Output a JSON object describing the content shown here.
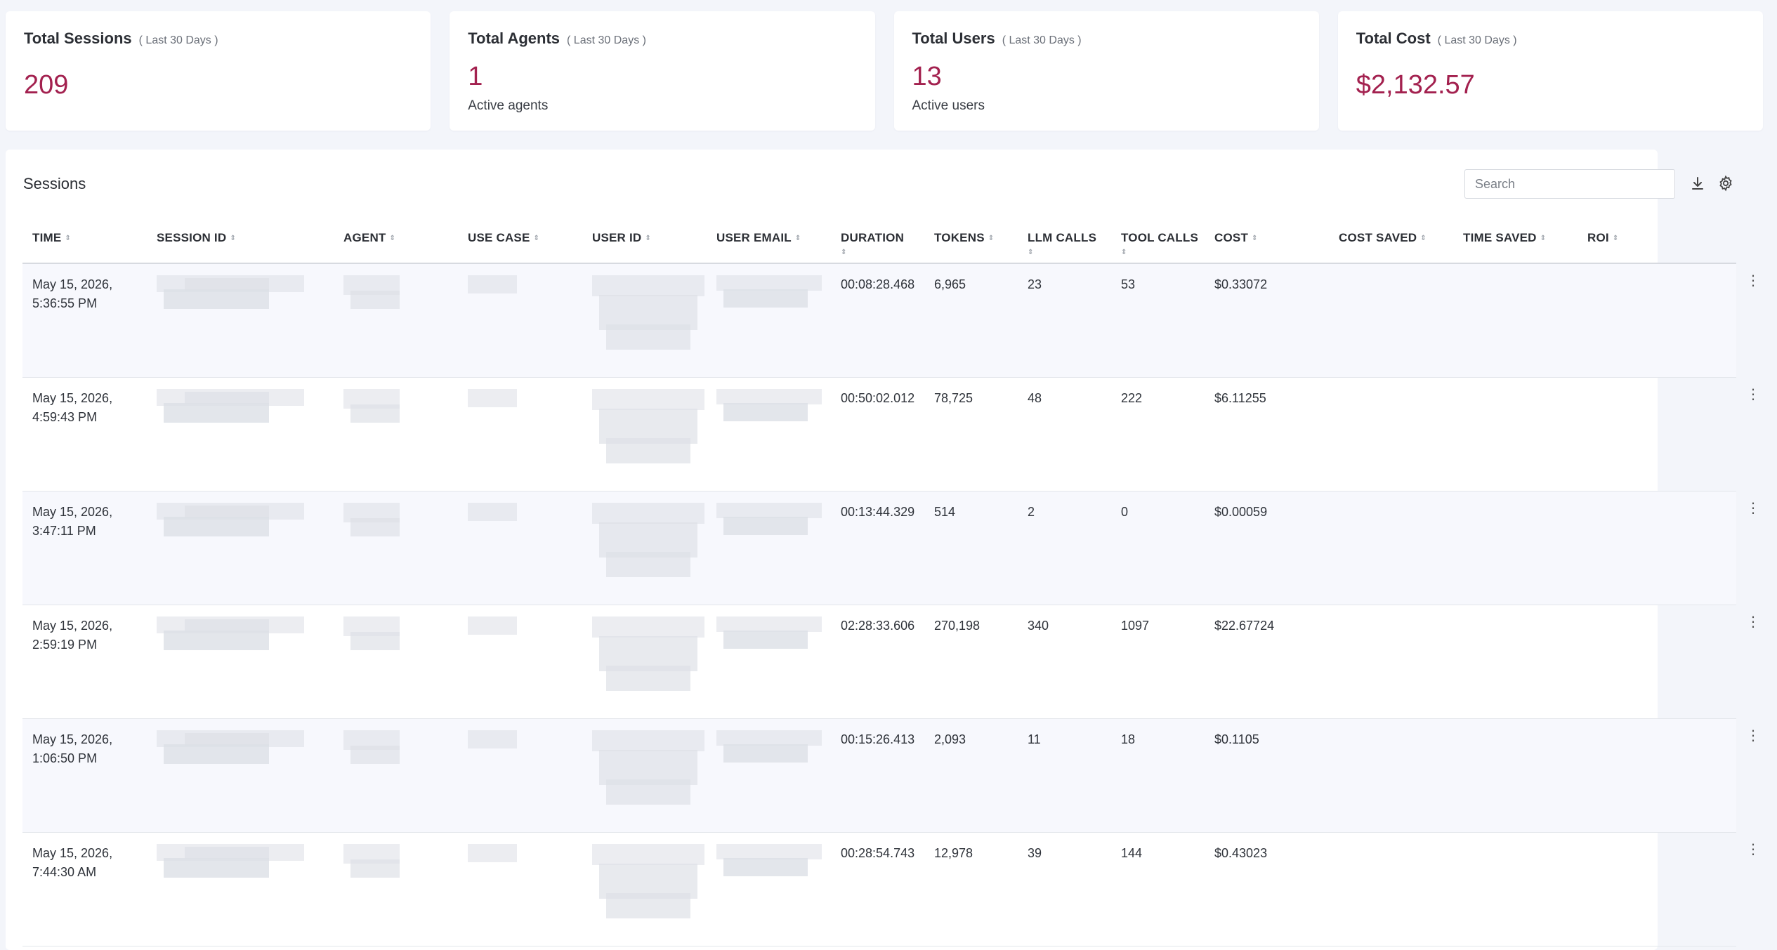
{
  "stats": [
    {
      "title": "Total Sessions",
      "period": "( Last 30 Days )",
      "value": "209",
      "sub": ""
    },
    {
      "title": "Total Agents",
      "period": "( Last 30 Days )",
      "value": "1",
      "sub": "Active agents"
    },
    {
      "title": "Total Users",
      "period": "( Last 30 Days )",
      "value": "13",
      "sub": "Active users"
    },
    {
      "title": "Total Cost",
      "period": "( Last 30 Days )",
      "value": "$2,132.57",
      "sub": ""
    }
  ],
  "sessions": {
    "title": "Sessions",
    "search_placeholder": "Search",
    "columns": [
      "TIME",
      "SESSION ID",
      "AGENT",
      "USE CASE",
      "USER ID",
      "USER EMAIL",
      "DURATION",
      "TOKENS",
      "LLM CALLS",
      "TOOL CALLS",
      "COST",
      "COST SAVED",
      "TIME SAVED",
      "ROI"
    ],
    "rows": [
      {
        "time_date": "May 15, 2026,",
        "time_clock": "5:36:55 PM",
        "duration": "00:08:28.468",
        "tokens": "6,965",
        "llm_calls": "23",
        "tool_calls": "53",
        "cost": "$0.33072",
        "cost_saved": "",
        "time_saved": "",
        "roi": ""
      },
      {
        "time_date": "May 15, 2026,",
        "time_clock": "4:59:43 PM",
        "duration": "00:50:02.012",
        "tokens": "78,725",
        "llm_calls": "48",
        "tool_calls": "222",
        "cost": "$6.11255",
        "cost_saved": "",
        "time_saved": "",
        "roi": ""
      },
      {
        "time_date": "May 15, 2026,",
        "time_clock": "3:47:11 PM",
        "duration": "00:13:44.329",
        "tokens": "514",
        "llm_calls": "2",
        "tool_calls": "0",
        "cost": "$0.00059",
        "cost_saved": "",
        "time_saved": "",
        "roi": ""
      },
      {
        "time_date": "May 15, 2026,",
        "time_clock": "2:59:19 PM",
        "duration": "02:28:33.606",
        "tokens": "270,198",
        "llm_calls": "340",
        "tool_calls": "1097",
        "cost": "$22.67724",
        "cost_saved": "",
        "time_saved": "",
        "roi": ""
      },
      {
        "time_date": "May 15, 2026,",
        "time_clock": "1:06:50 PM",
        "duration": "00:15:26.413",
        "tokens": "2,093",
        "llm_calls": "11",
        "tool_calls": "18",
        "cost": "$0.1105",
        "cost_saved": "",
        "time_saved": "",
        "roi": ""
      },
      {
        "time_date": "May 15, 2026,",
        "time_clock": "7:44:30 AM",
        "duration": "00:28:54.743",
        "tokens": "12,978",
        "llm_calls": "39",
        "tool_calls": "144",
        "cost": "$0.43023",
        "cost_saved": "",
        "time_saved": "",
        "roi": ""
      }
    ]
  }
}
